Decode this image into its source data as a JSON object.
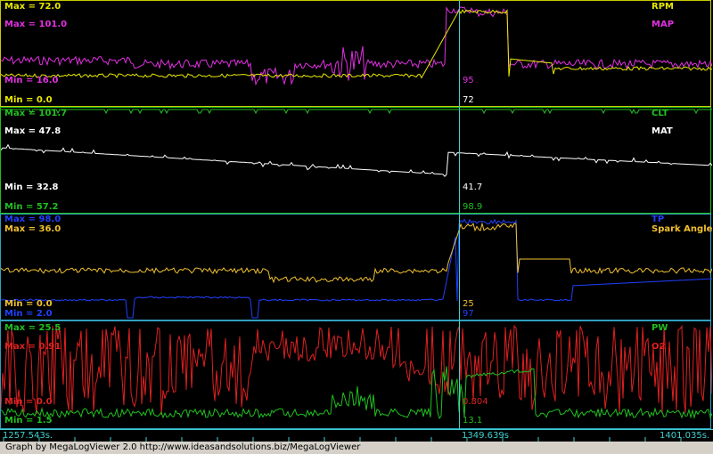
{
  "panels": [
    {
      "id": "p1",
      "left": [
        {
          "text": "Max = 72.0",
          "color": "#e8e800"
        },
        {
          "text": "Max = 101.0",
          "color": "#e030e0"
        },
        {
          "text": "Min = 16.0",
          "color": "#e030e0"
        },
        {
          "text": "Min = 0.0",
          "color": "#e8e800"
        }
      ],
      "right": [
        {
          "text": "RPM",
          "color": "#e8e800"
        },
        {
          "text": "MAP",
          "color": "#e030e0"
        }
      ],
      "cursor_values": [
        {
          "text": "95",
          "color": "#e030e0"
        },
        {
          "text": "72",
          "color": "#ffffff"
        }
      ]
    },
    {
      "id": "p2",
      "left": [
        {
          "text": "Max = 101.7",
          "color": "#20c020"
        },
        {
          "text": "Max = 47.8",
          "color": "#ffffff"
        },
        {
          "text": "Min = 32.8",
          "color": "#ffffff"
        },
        {
          "text": "Min = 57.2",
          "color": "#20c020"
        }
      ],
      "right": [
        {
          "text": "CLT",
          "color": "#20c020"
        },
        {
          "text": "MAT",
          "color": "#ffffff"
        }
      ],
      "cursor_values": [
        {
          "text": "41.7",
          "color": "#ffffff"
        },
        {
          "text": "98.9",
          "color": "#20c020"
        }
      ]
    },
    {
      "id": "p3",
      "left": [
        {
          "text": "Max = 98.0",
          "color": "#2040ff"
        },
        {
          "text": "Max = 36.0",
          "color": "#f0c030"
        },
        {
          "text": "Min = 0.0",
          "color": "#f0c030"
        },
        {
          "text": "Min = 2.0",
          "color": "#2040ff"
        }
      ],
      "right": [
        {
          "text": "TP",
          "color": "#2040ff"
        },
        {
          "text": "Spark Angle",
          "color": "#f0c030"
        }
      ],
      "cursor_values": [
        {
          "text": "25",
          "color": "#f0c030"
        },
        {
          "text": "97",
          "color": "#2040ff"
        }
      ]
    },
    {
      "id": "p4",
      "left": [
        {
          "text": "Max = 25.5",
          "color": "#20c020"
        },
        {
          "text": "Max = 0.91",
          "color": "#e02020"
        },
        {
          "text": "Min = 0.0",
          "color": "#e02020"
        },
        {
          "text": "Min = 1.5",
          "color": "#20c020"
        }
      ],
      "right": [
        {
          "text": "PW",
          "color": "#20c020"
        },
        {
          "text": "O2",
          "color": "#e02020"
        }
      ],
      "cursor_values": [
        {
          "text": "0.804",
          "color": "#e02020"
        },
        {
          "text": "13.1",
          "color": "#20c020"
        }
      ]
    }
  ],
  "timeline": {
    "start": "1257.543s.",
    "cursor": "1349.639s",
    "end": "1401.035s."
  },
  "footer": "Graph by MegaLogViewer 2.0 http://www.ideasandsolutions.biz/MegaLogViewer",
  "colors": {
    "rpm": "#e8e800",
    "map": "#e030e0",
    "clt": "#20c020",
    "mat": "#ffffff",
    "tp": "#2040ff",
    "spark": "#f0c030",
    "pw": "#20c020",
    "o2": "#e02020",
    "cursor": "#40d0d0"
  }
}
